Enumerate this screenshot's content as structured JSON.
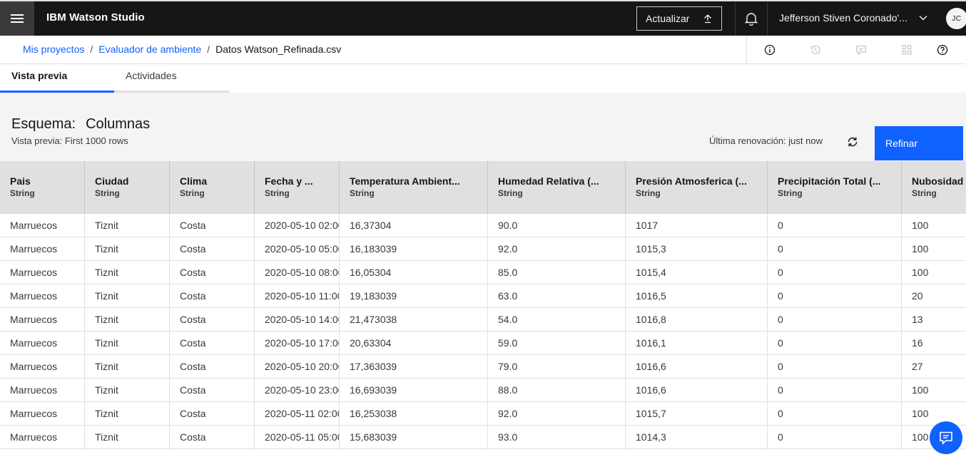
{
  "header": {
    "menu_icon": "hamburger-icon",
    "brand": "IBM Watson Studio",
    "update_label": "Actualizar",
    "user_name": "Jefferson Stiven Coronado'...",
    "avatar_initials": "JC"
  },
  "breadcrumb": {
    "items": [
      "Mis proyectos",
      "Evaluador de ambiente"
    ],
    "separator": "/",
    "current": "Datos Watson_Refinada.csv"
  },
  "toolbar_icons": [
    "info-icon",
    "history-icon",
    "comment-icon",
    "apps-icon",
    "help-icon"
  ],
  "tabs": [
    "Vista previa",
    "Actividades"
  ],
  "schema": {
    "label": "Esquema:",
    "value": "Columnas",
    "preview": "Vista previa: First 1000 rows",
    "last_refresh": "Última renovación: just now",
    "refine_button": "Refinar"
  },
  "table": {
    "columns": [
      {
        "name": "Pais",
        "type": "String"
      },
      {
        "name": "Ciudad",
        "type": "String"
      },
      {
        "name": "Clima",
        "type": "String"
      },
      {
        "name": "Fecha y ...",
        "type": "String"
      },
      {
        "name": "Temperatura Ambient...",
        "type": "String"
      },
      {
        "name": "Humedad Relativa (...",
        "type": "String"
      },
      {
        "name": "Presión Atmosferica (...",
        "type": "String"
      },
      {
        "name": "Precipitación Total (...",
        "type": "String"
      },
      {
        "name": "Nubosidad T",
        "type": "String"
      }
    ],
    "rows": [
      [
        "Marruecos",
        "Tiznit",
        "Costa",
        "2020-05-10 02:00",
        "16,37304",
        "90.0",
        "1017",
        "0",
        "100"
      ],
      [
        "Marruecos",
        "Tiznit",
        "Costa",
        "2020-05-10 05:00",
        "16,183039",
        "92.0",
        "1015,3",
        "0",
        "100"
      ],
      [
        "Marruecos",
        "Tiznit",
        "Costa",
        "2020-05-10 08:00",
        "16,05304",
        "85.0",
        "1015,4",
        "0",
        "100"
      ],
      [
        "Marruecos",
        "Tiznit",
        "Costa",
        "2020-05-10 11:00",
        "19,183039",
        "63.0",
        "1016,5",
        "0",
        "20"
      ],
      [
        "Marruecos",
        "Tiznit",
        "Costa",
        "2020-05-10 14:00",
        "21,473038",
        "54.0",
        "1016,8",
        "0",
        "13"
      ],
      [
        "Marruecos",
        "Tiznit",
        "Costa",
        "2020-05-10 17:00",
        "20,63304",
        "59.0",
        "1016,1",
        "0",
        "16"
      ],
      [
        "Marruecos",
        "Tiznit",
        "Costa",
        "2020-05-10 20:00",
        "17,363039",
        "79.0",
        "1016,6",
        "0",
        "27"
      ],
      [
        "Marruecos",
        "Tiznit",
        "Costa",
        "2020-05-10 23:00",
        "16,693039",
        "88.0",
        "1016,6",
        "0",
        "100"
      ],
      [
        "Marruecos",
        "Tiznit",
        "Costa",
        "2020-05-11 02:00",
        "16,253038",
        "92.0",
        "1015,7",
        "0",
        "100"
      ],
      [
        "Marruecos",
        "Tiznit",
        "Costa",
        "2020-05-11 05:00",
        "15,683039",
        "93.0",
        "1014,3",
        "0",
        "100"
      ]
    ]
  },
  "chat_icon": "chat-icon",
  "colors": {
    "primary": "#0f62fe",
    "header_bg": "#161616",
    "header_accent": "#393939",
    "panel_bg": "#f4f4f4",
    "table_header_bg": "#e0e0e0"
  }
}
